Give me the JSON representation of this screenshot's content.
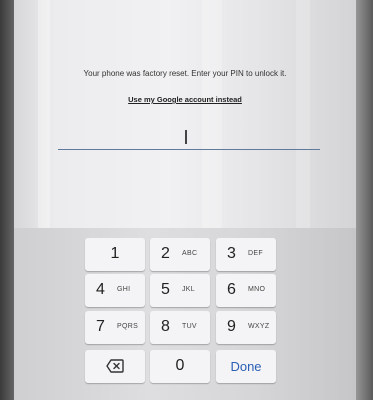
{
  "prompt_text": "Your phone was factory reset. Enter your PIN to unlock it.",
  "alternate_link": "Use my Google account instead",
  "pin_field": {
    "value": ""
  },
  "keypad": {
    "keys": [
      {
        "digit": "1",
        "letters": ""
      },
      {
        "digit": "2",
        "letters": "ABC"
      },
      {
        "digit": "3",
        "letters": "DEF"
      },
      {
        "digit": "4",
        "letters": "GHI"
      },
      {
        "digit": "5",
        "letters": "JKL"
      },
      {
        "digit": "6",
        "letters": "MNO"
      },
      {
        "digit": "7",
        "letters": "PQRS"
      },
      {
        "digit": "8",
        "letters": "TUV"
      },
      {
        "digit": "9",
        "letters": "WXYZ"
      },
      {
        "digit": "0",
        "letters": ""
      }
    ],
    "backspace_icon": "backspace-icon",
    "done_label": "Done"
  },
  "colors": {
    "done_text": "#2a5fb3",
    "underline": "#5f7a9a"
  }
}
